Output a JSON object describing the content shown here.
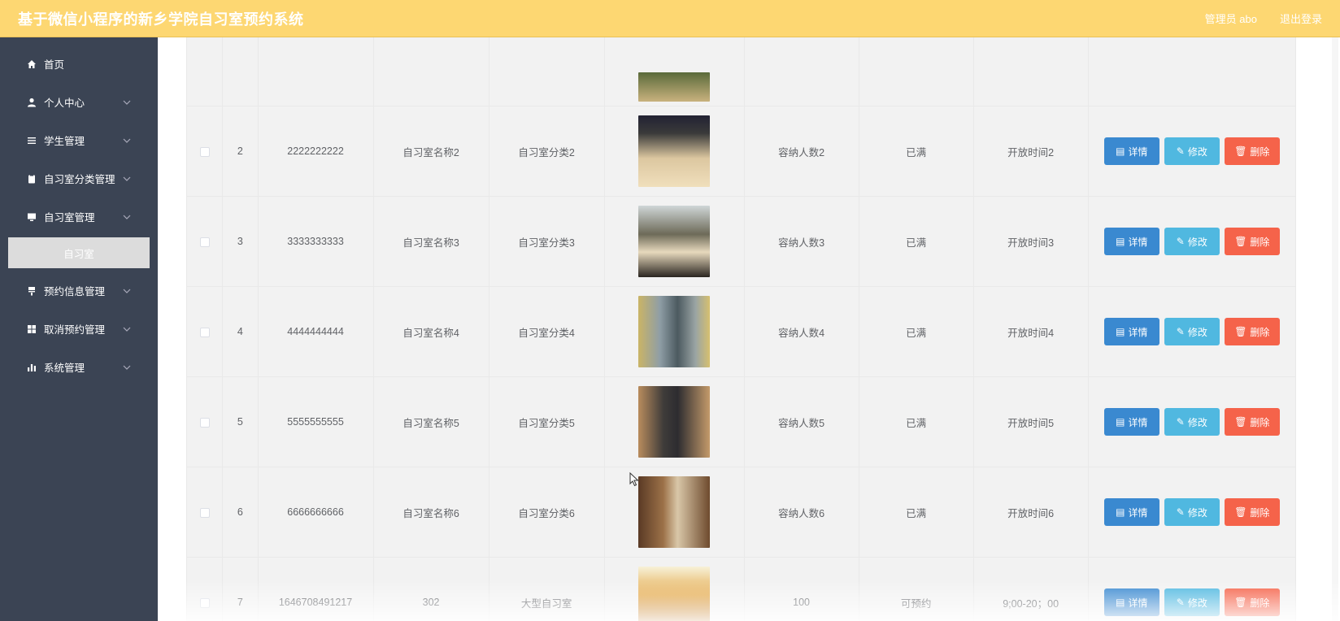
{
  "header": {
    "title": "基于微信小程序的新乡学院自习室预约系统",
    "user": "管理员 abo",
    "logout": "退出登录"
  },
  "sidebar": {
    "items": [
      {
        "label": "首页",
        "icon": "home-icon"
      },
      {
        "label": "个人中心",
        "icon": "user-icon"
      },
      {
        "label": "学生管理",
        "icon": "list-icon"
      },
      {
        "label": "自习室分类管理",
        "icon": "clipboard-icon"
      },
      {
        "label": "自习室管理",
        "icon": "monitor-icon"
      },
      {
        "label": "预约信息管理",
        "icon": "bookmark-icon"
      },
      {
        "label": "取消预约管理",
        "icon": "grid-icon"
      },
      {
        "label": "系统管理",
        "icon": "bar-chart-icon"
      }
    ],
    "active_sub": "自习室"
  },
  "actions": {
    "detail": "详情",
    "edit": "修改",
    "delete": "删除"
  },
  "rows": [
    {
      "index": "2",
      "number": "2222222222",
      "name": "自习室名称2",
      "category": "自习室分类2",
      "capacity": "容纳人数2",
      "status": "已满",
      "open_time": "开放时间2"
    },
    {
      "index": "3",
      "number": "3333333333",
      "name": "自习室名称3",
      "category": "自习室分类3",
      "capacity": "容纳人数3",
      "status": "已满",
      "open_time": "开放时间3"
    },
    {
      "index": "4",
      "number": "4444444444",
      "name": "自习室名称4",
      "category": "自习室分类4",
      "capacity": "容纳人数4",
      "status": "已满",
      "open_time": "开放时间4"
    },
    {
      "index": "5",
      "number": "5555555555",
      "name": "自习室名称5",
      "category": "自习室分类5",
      "capacity": "容纳人数5",
      "status": "已满",
      "open_time": "开放时间5"
    },
    {
      "index": "6",
      "number": "6666666666",
      "name": "自习室名称6",
      "category": "自习室分类6",
      "capacity": "容纳人数6",
      "status": "已满",
      "open_time": "开放时间6"
    },
    {
      "index": "7",
      "number": "1646708491217",
      "name": "302",
      "category": "大型自习室",
      "capacity": "100",
      "status": "可预约",
      "open_time": "9;00-20；00"
    }
  ]
}
